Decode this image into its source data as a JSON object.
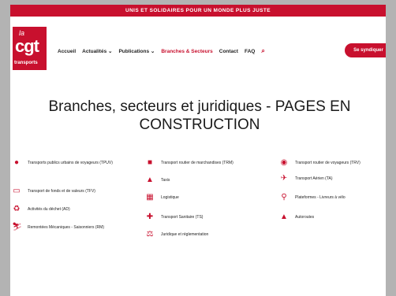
{
  "topbar": {
    "slogan": "UNIS ET SOLIDAIRES POUR UN MONDE PLUS JUSTE"
  },
  "logo": {
    "la": "la",
    "cgt": "cgt",
    "sub": "transports"
  },
  "nav": {
    "items": [
      "Accueil",
      "Actualités ⌄",
      "Publications ⌄",
      "Branches & Secteurs",
      "Contact",
      "FAQ"
    ],
    "active_index": 3,
    "search_icon": "search-icon"
  },
  "cta": {
    "label": "Se syndiquer"
  },
  "page": {
    "title": "Branches, secteurs et juridiques - PAGES EN CONSTRUCTION"
  },
  "colors": {
    "brand": "#c8102e"
  },
  "columns": [
    [
      {
        "icon": "person-icon",
        "label": "Transports publics urbains de voyageurs (TPUV)"
      },
      {
        "icon": "money-icon",
        "label": "Transport de fonds et de valeurs (TFV)"
      },
      {
        "icon": "recycle-icon",
        "label": "Activités du déchet (AD)"
      },
      {
        "icon": "skier-icon",
        "label": "Remontées Mécaniques - Saisonniers (RM)"
      }
    ],
    [
      {
        "icon": "truck-icon",
        "label": "Transport routier de marchandises (TRM)"
      },
      {
        "icon": "taxi-icon",
        "label": "Taxis"
      },
      {
        "icon": "boxes-icon",
        "label": "Logistique"
      },
      {
        "icon": "ambulance-icon",
        "label": "Transport Sanitaire (TS)"
      },
      {
        "icon": "scales-icon",
        "label": "Juridique et réglementation"
      }
    ],
    [
      {
        "icon": "bus-icon",
        "label": "Transport routier de voyageurs (TRV)"
      },
      {
        "icon": "plane-icon",
        "label": "Transport Aérien (TA)"
      },
      {
        "icon": "bicycle-icon",
        "label": "Plateformes - Livreurs à vélo"
      },
      {
        "icon": "road-icon",
        "label": "Autoroutes"
      }
    ]
  ]
}
